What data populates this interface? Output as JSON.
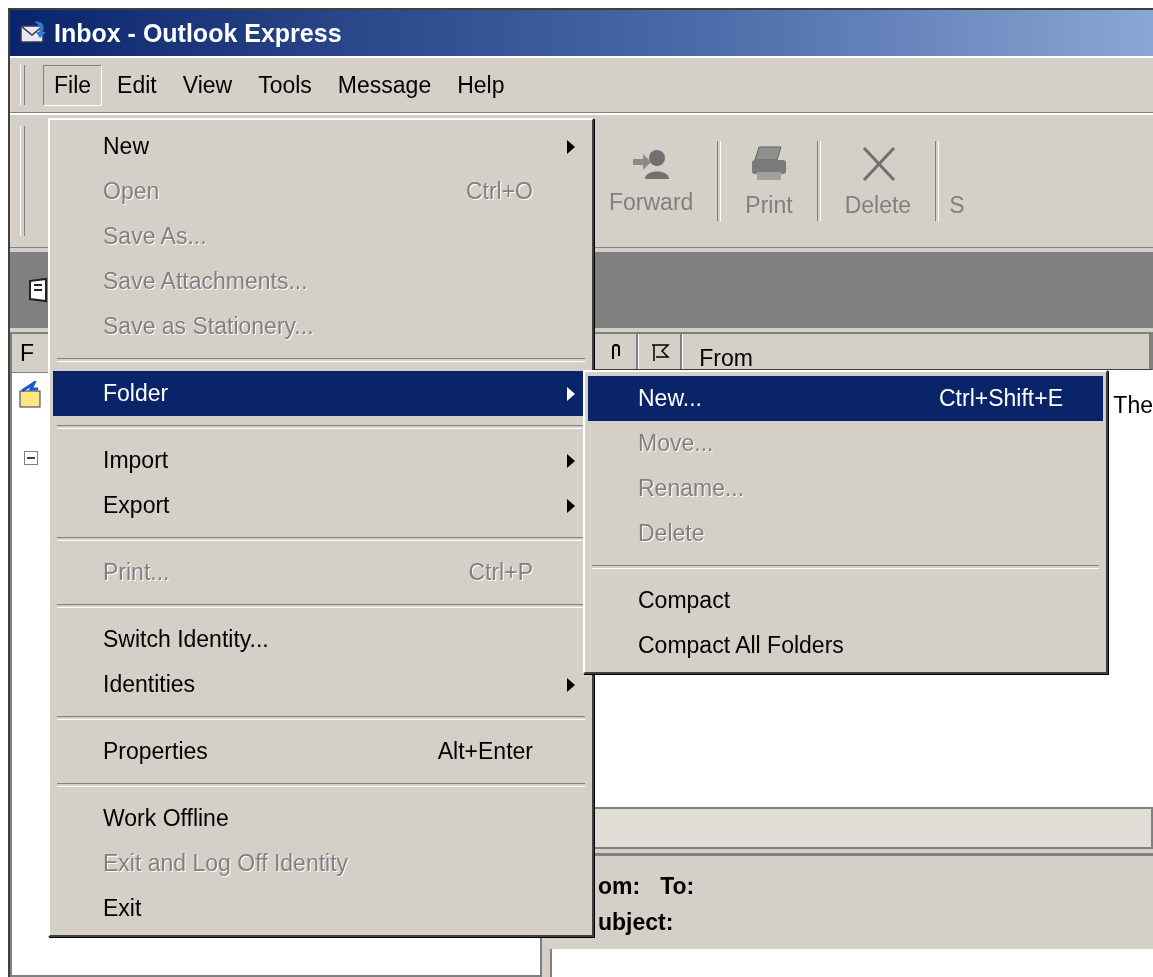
{
  "window": {
    "title": "Inbox - Outlook Express"
  },
  "menubar": [
    {
      "label": "File",
      "selected": true
    },
    {
      "label": "Edit",
      "selected": false
    },
    {
      "label": "View",
      "selected": false
    },
    {
      "label": "Tools",
      "selected": false
    },
    {
      "label": "Message",
      "selected": false
    },
    {
      "label": "Help",
      "selected": false
    }
  ],
  "toolbar": [
    {
      "kind": "forward",
      "label": "Forward"
    },
    {
      "kind": "print",
      "label": "Print"
    },
    {
      "kind": "delete",
      "label": "Delete"
    },
    {
      "kind": "cut",
      "label": "S"
    }
  ],
  "folder_pane": {
    "header": "F"
  },
  "message_list": {
    "columns": [
      {
        "kind": "attachment"
      },
      {
        "kind": "flag"
      },
      {
        "kind": "text",
        "label": "From"
      }
    ],
    "rows": [
      {
        "text": "The"
      }
    ]
  },
  "preview": {
    "fields": [
      "om:",
      "To:",
      "ubject:"
    ]
  },
  "file_menu": {
    "items": [
      {
        "kind": "item",
        "label": "New",
        "submenu": true,
        "disabled": false,
        "selected": false
      },
      {
        "kind": "item",
        "label": "Open",
        "shortcut": "Ctrl+O",
        "submenu": false,
        "disabled": true,
        "selected": false
      },
      {
        "kind": "item",
        "label": "Save As...",
        "submenu": false,
        "disabled": true,
        "selected": false
      },
      {
        "kind": "item",
        "label": "Save Attachments...",
        "submenu": false,
        "disabled": true,
        "selected": false
      },
      {
        "kind": "item",
        "label": "Save as Stationery...",
        "submenu": false,
        "disabled": true,
        "selected": false
      },
      {
        "kind": "separator"
      },
      {
        "kind": "item",
        "label": "Folder",
        "submenu": true,
        "disabled": false,
        "selected": true
      },
      {
        "kind": "separator"
      },
      {
        "kind": "item",
        "label": "Import",
        "submenu": true,
        "disabled": false,
        "selected": false
      },
      {
        "kind": "item",
        "label": "Export",
        "submenu": true,
        "disabled": false,
        "selected": false
      },
      {
        "kind": "separator"
      },
      {
        "kind": "item",
        "label": "Print...",
        "shortcut": "Ctrl+P",
        "submenu": false,
        "disabled": true,
        "selected": false
      },
      {
        "kind": "separator"
      },
      {
        "kind": "item",
        "label": "Switch Identity...",
        "submenu": false,
        "disabled": false,
        "selected": false
      },
      {
        "kind": "item",
        "label": "Identities",
        "submenu": true,
        "disabled": false,
        "selected": false
      },
      {
        "kind": "separator"
      },
      {
        "kind": "item",
        "label": "Properties",
        "shortcut": "Alt+Enter",
        "submenu": false,
        "disabled": false,
        "selected": false
      },
      {
        "kind": "separator"
      },
      {
        "kind": "item",
        "label": "Work Offline",
        "submenu": false,
        "disabled": false,
        "selected": false
      },
      {
        "kind": "item",
        "label": "Exit and Log Off Identity",
        "submenu": false,
        "disabled": true,
        "selected": false
      },
      {
        "kind": "item",
        "label": "Exit",
        "submenu": false,
        "disabled": false,
        "selected": false
      }
    ]
  },
  "folder_submenu": {
    "items": [
      {
        "kind": "item",
        "label": "New...",
        "shortcut": "Ctrl+Shift+E",
        "submenu": false,
        "disabled": false,
        "selected": true
      },
      {
        "kind": "item",
        "label": "Move...",
        "submenu": false,
        "disabled": true,
        "selected": false
      },
      {
        "kind": "item",
        "label": "Rename...",
        "submenu": false,
        "disabled": true,
        "selected": false
      },
      {
        "kind": "item",
        "label": "Delete",
        "submenu": false,
        "disabled": true,
        "selected": false
      },
      {
        "kind": "separator"
      },
      {
        "kind": "item",
        "label": "Compact",
        "submenu": false,
        "disabled": false,
        "selected": false
      },
      {
        "kind": "item",
        "label": "Compact All Folders",
        "submenu": false,
        "disabled": false,
        "selected": false
      }
    ]
  }
}
